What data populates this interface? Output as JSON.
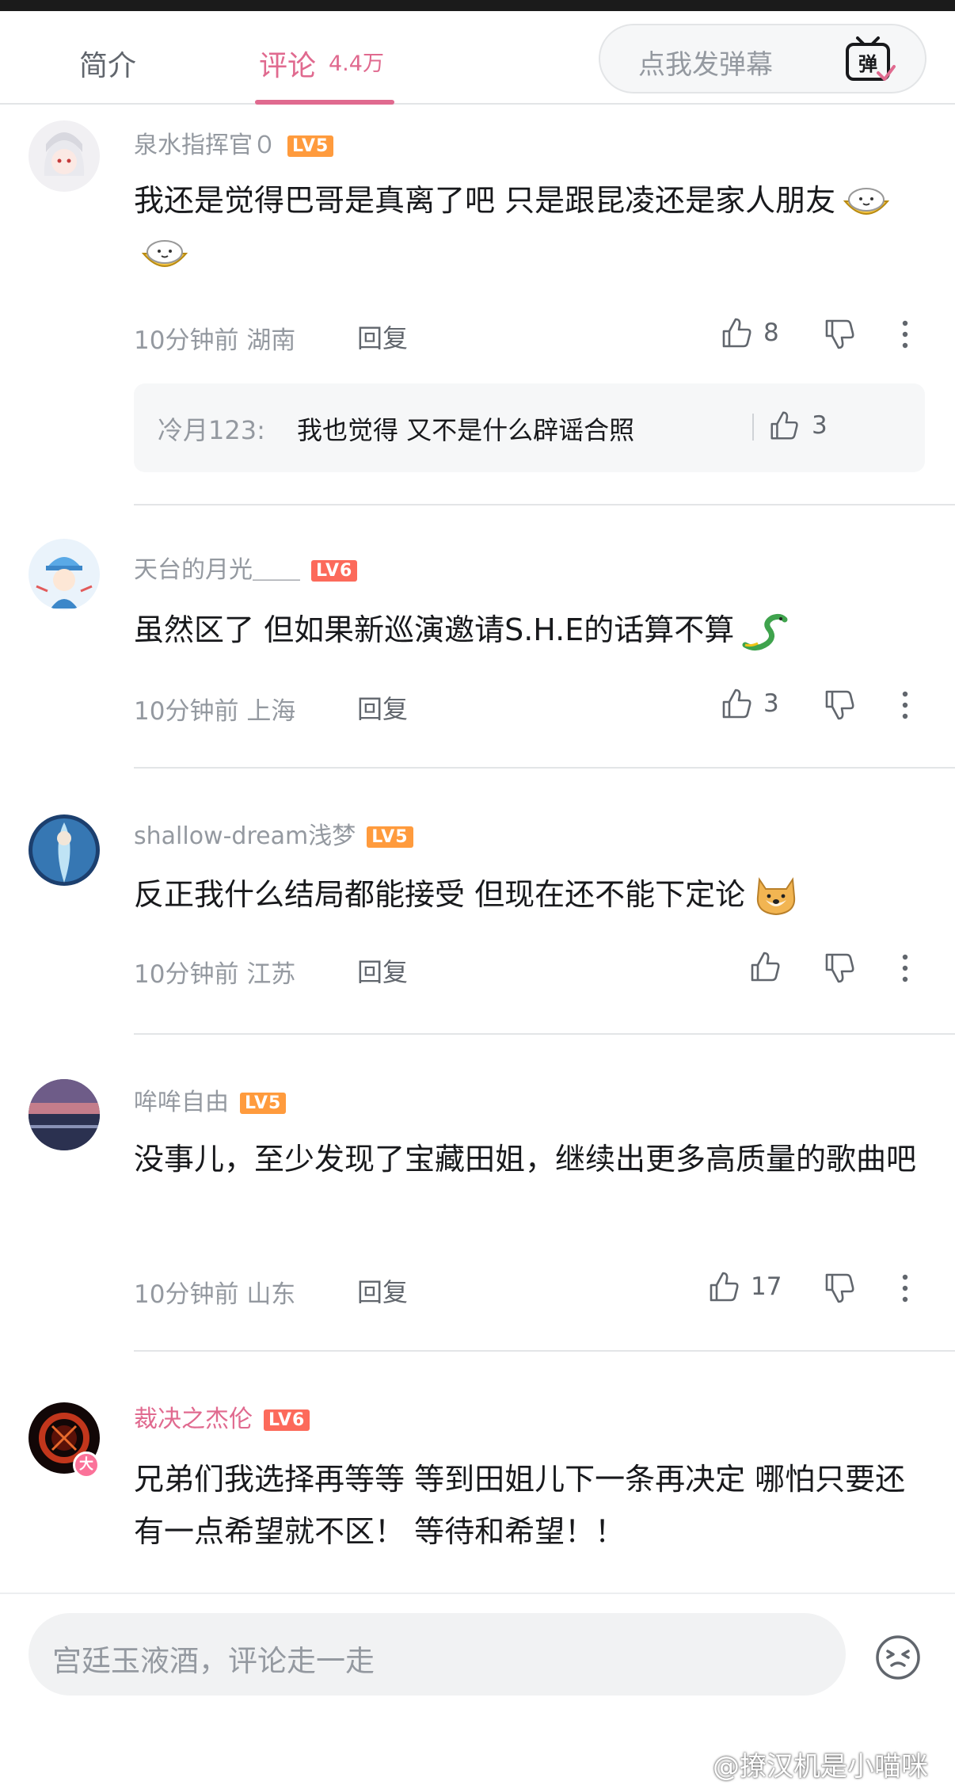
{
  "header": {
    "tab_intro": "简介",
    "tab_comments": "评论",
    "comment_count": "4.4万",
    "danmaku_placeholder": "点我发弹幕",
    "danmaku_icon_label": "弹"
  },
  "colors": {
    "accent_pink": "#e06a8f",
    "lv5": "#ff9b3d",
    "lv6": "#fc6a5b"
  },
  "comments": [
    {
      "username": "泉水指挥官０",
      "level": "LV5",
      "text": "我还是觉得巴哥是真离了吧 只是跟昆凌还是家人朋友",
      "emotes": [
        "rice-bowl-emote",
        "rice-bowl-emote"
      ],
      "time": "10分钟前",
      "location": "湖南",
      "reply_label": "回复",
      "likes": "8",
      "sub_reply": {
        "user": "冷月123:",
        "text": "我也觉得 又不是什么辟谣合照",
        "likes": "3"
      }
    },
    {
      "username": "天台的月光＿＿",
      "level": "LV6",
      "text": "虽然区了 但如果新巡演邀请S.H.E的话算不算",
      "emotes": [
        "green-dragon-emote"
      ],
      "time": "10分钟前",
      "location": "上海",
      "reply_label": "回复",
      "likes": "3"
    },
    {
      "username": "shallow-dream浅梦",
      "level": "LV5",
      "text": "反正我什么结局都能接受 但现在还不能下定论",
      "emotes": [
        "doge-emote"
      ],
      "time": "10分钟前",
      "location": "江苏",
      "reply_label": "回复",
      "likes": ""
    },
    {
      "username": "哞哞自由",
      "level": "LV5",
      "text": "没事儿，至少发现了宝藏田姐，继续出更多高质量的歌曲吧",
      "time": "10分钟前",
      "location": "山东",
      "reply_label": "回复",
      "likes": "17"
    },
    {
      "username": "裁决之杰伦",
      "level": "LV6",
      "badge": "大",
      "text": "兄弟们我选择再等等  等到田姐儿下一条再决定 哪怕只要还有一点希望就不区！ 等待和希望！！"
    }
  ],
  "composer": {
    "placeholder": "宫廷玉液酒，评论走一走"
  },
  "watermark": "@撩汉机是小喵咪"
}
